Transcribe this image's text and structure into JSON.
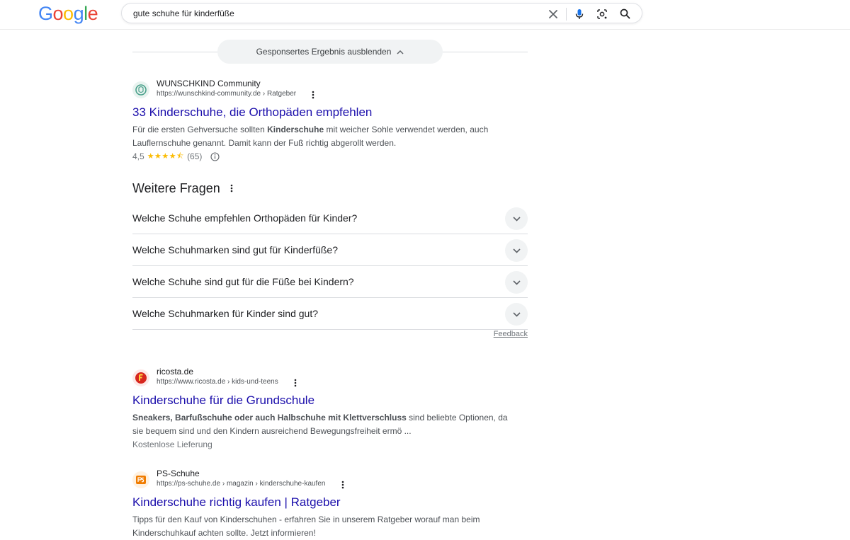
{
  "header": {
    "logo": [
      "G",
      "o",
      "o",
      "g",
      "l",
      "e"
    ],
    "logo_colors": [
      "#4285F4",
      "#EA4335",
      "#FBBC05",
      "#4285F4",
      "#34A853",
      "#EA4335"
    ],
    "search_value": "gute schuhe für kinderfüße"
  },
  "sponsored": {
    "toggle_label": "Gesponsertes Ergebnis ausblenden"
  },
  "results": [
    {
      "site": "WUNSCHKIND Community",
      "url": "https://wunschkind-community.de › Ratgeber",
      "title": "33 Kinderschuhe, die Orthopäden empfehlen",
      "snippet_pre": "Für die ersten Gehversuche sollten ",
      "snippet_bold": "Kinderschuhe",
      "snippet_post": " mit weicher Sohle verwendet werden, auch Lauflernschuhe genannt. Damit kann der Fuß richtig abgerollt werden.",
      "rating": "4,5",
      "stars": "★★★★⯪",
      "reviews": "(65)"
    },
    {
      "site": "ricosta.de",
      "url": "https://www.ricosta.de › kids-und-teens",
      "title": "Kinderschuhe für die Grundschule",
      "snippet_bold": "Sneakers, Barfußschuhe oder auch Halbschuhe mit Klettverschluss",
      "snippet_post": " sind beliebte Optionen, da sie bequem sind und den Kindern ausreichend Bewegungsfreiheit ermö ...",
      "extra": "Kostenlose Lieferung"
    },
    {
      "site": "PS-Schuhe",
      "url": "https://ps-schuhe.de › magazin › kinderschuhe-kaufen",
      "title": "Kinderschuhe richtig kaufen | Ratgeber",
      "snippet": "Tipps für den Kauf von Kinderschuhen - erfahren Sie in unserem Ratgeber worauf man beim Kinderschuhkauf achten sollte. Jetzt informieren!"
    }
  ],
  "paa": {
    "title": "Weitere Fragen",
    "questions": [
      "Welche Schuhe empfehlen Orthopäden für Kinder?",
      "Welche Schuhmarken sind gut für Kinderfüße?",
      "Welche Schuhe sind gut für die Füße bei Kindern?",
      "Welche Schuhmarken für Kinder sind gut?"
    ],
    "feedback": "Feedback"
  },
  "colors": {
    "link": "#1a0dab",
    "star": "#fbbc04",
    "ricosta_brand": "#d7261e",
    "psschuhe_brand": "#f07c00"
  },
  "icons": [
    "clear-icon",
    "microphone-icon",
    "lens-icon",
    "search-icon",
    "chevron-up-icon",
    "more-vert-icon",
    "info-icon",
    "chevron-down-icon"
  ]
}
